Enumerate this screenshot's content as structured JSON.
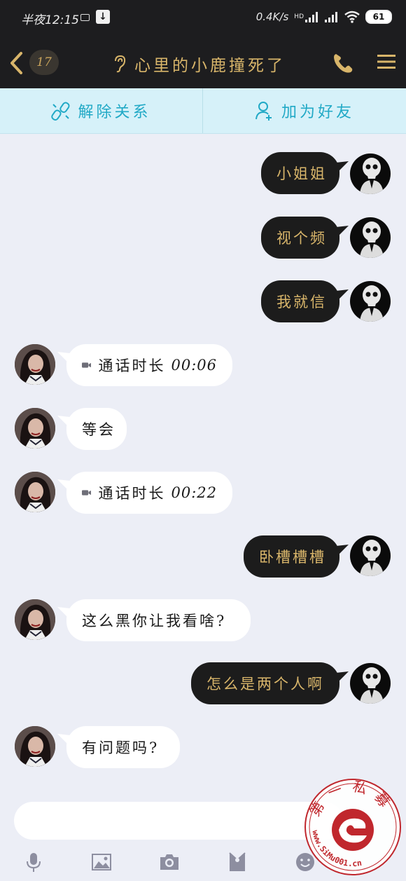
{
  "status": {
    "time": "半夜12:15",
    "network_speed": "0.4K/s",
    "network_tag": "HD",
    "battery": "61"
  },
  "header": {
    "unread_count": "17",
    "title": "心里的小鹿撞死了"
  },
  "actions": {
    "unbind_label": "解除关系",
    "add_friend_label": "加为好友"
  },
  "messages": [
    {
      "from": "me",
      "text": "小姐姐"
    },
    {
      "from": "me",
      "text": "视个频"
    },
    {
      "from": "me",
      "text": "我就信"
    },
    {
      "from": "them",
      "type": "call",
      "text": "通话时长",
      "duration": "00:06"
    },
    {
      "from": "them",
      "text": "等会"
    },
    {
      "from": "them",
      "type": "call",
      "text": "通话时长",
      "duration": "00:22"
    },
    {
      "from": "me",
      "text": "卧槽槽槽"
    },
    {
      "from": "them",
      "text": "这么黑你让我看啥?"
    },
    {
      "from": "me",
      "text": "怎么是两个人啊"
    },
    {
      "from": "them",
      "text": "有问题吗?"
    }
  ],
  "input": {
    "placeholder": ""
  },
  "toolbar_icons": [
    "mic-icon",
    "image-icon",
    "camera-icon",
    "red-packet-icon",
    "emoji-icon"
  ],
  "watermark": {
    "top_text": "第一私募",
    "bottom_text": "www.SiMu001.cn"
  },
  "colors": {
    "gold": "#d8b56a",
    "dark": "#1d1d1f",
    "cyan": "#21a9c6",
    "chat_bg": "#eceef6",
    "watermark_red": "#c0272d"
  }
}
